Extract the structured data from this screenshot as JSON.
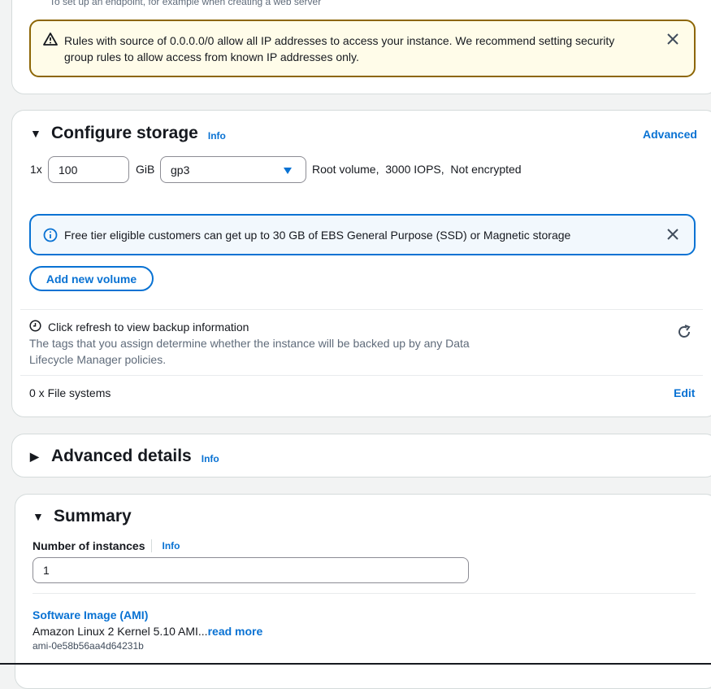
{
  "top_panel": {
    "partial_text": "To set up an endpoint, for example when creating a web server",
    "warning_alert": {
      "line1": "Rules with source of 0.0.0.0/0 allow all IP addresses to access your instance. We recommend setting security",
      "line2": "group rules to allow access from known IP addresses only."
    }
  },
  "storage": {
    "title": "Configure storage",
    "info_label": "Info",
    "advanced_label": "Advanced",
    "count_prefix": "1x",
    "size_value": "100",
    "unit_label": "GiB",
    "volume_type": "gp3",
    "volume_desc": "Root volume,  3000 IOPS,  Not encrypted",
    "free_tier_alert": "Free tier eligible customers can get up to 30 GB of EBS General Purpose (SSD) or Magnetic storage",
    "add_volume_label": "Add new volume",
    "backup_title": "Click refresh to view backup information",
    "backup_desc_line1": "The tags that you assign determine whether the instance will be backed up by any Data",
    "backup_desc_line2": "Lifecycle Manager policies.",
    "file_systems_label": "0 x File systems",
    "edit_label": "Edit"
  },
  "advanced_details": {
    "title": "Advanced details",
    "info_label": "Info"
  },
  "summary": {
    "title": "Summary",
    "instances_label": "Number of instances",
    "info_label": "Info",
    "instances_value": "1",
    "ami_heading": "Software Image (AMI)",
    "ami_name": "Amazon Linux 2 Kernel 5.10 AMI...",
    "read_more": "read more",
    "ami_id": "ami-0e58b56aa4d64231b"
  },
  "colors": {
    "link_blue": "#0972d3",
    "warning_border": "#8d6605",
    "warning_bg": "#fffce9",
    "info_border": "#0972d3",
    "info_bg": "#f2f8fd"
  }
}
